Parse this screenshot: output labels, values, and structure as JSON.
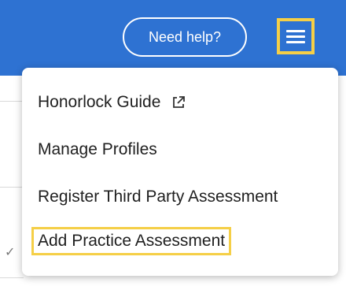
{
  "header": {
    "help_label": "Need help?",
    "menu_icon": "hamburger-menu-icon"
  },
  "dropdown": {
    "items": [
      {
        "label": "Honorlock Guide",
        "icon": "external-link-icon",
        "highlighted": false
      },
      {
        "label": "Manage Profiles",
        "highlighted": false
      },
      {
        "label": "Register Third Party Assessment",
        "highlighted": false
      },
      {
        "label": "Add Practice Assessment",
        "highlighted": true
      }
    ]
  },
  "background": {
    "check_icon": "checkmark-icon"
  },
  "colors": {
    "header_bg": "#2e72d2",
    "highlight": "#f5cf47",
    "text": "#1f1f1f"
  }
}
